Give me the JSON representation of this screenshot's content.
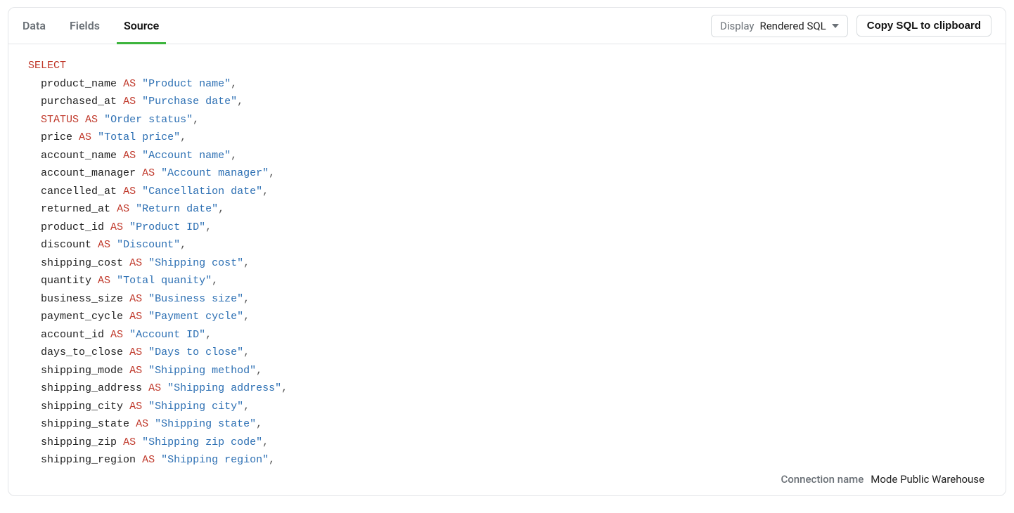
{
  "tabs": [
    {
      "label": "Data",
      "active": false
    },
    {
      "label": "Fields",
      "active": false
    },
    {
      "label": "Source",
      "active": true
    }
  ],
  "display_control": {
    "label": "Display",
    "value": "Rendered SQL"
  },
  "copy_button_label": "Copy SQL to clipboard",
  "sql": {
    "keyword_select": "SELECT",
    "keyword_as": "AS",
    "comma": ",",
    "indent": "  ",
    "columns": [
      {
        "col": "product_name",
        "alias": "\"Product name\""
      },
      {
        "col": "purchased_at",
        "alias": "\"Purchase date\""
      },
      {
        "col": "STATUS",
        "col_is_keyword": true,
        "alias": "\"Order status\""
      },
      {
        "col": "price",
        "alias": "\"Total price\""
      },
      {
        "col": "account_name",
        "alias": "\"Account name\""
      },
      {
        "col": "account_manager",
        "alias": "\"Account manager\""
      },
      {
        "col": "cancelled_at",
        "alias": "\"Cancellation date\""
      },
      {
        "col": "returned_at",
        "alias": "\"Return date\""
      },
      {
        "col": "product_id",
        "alias": "\"Product ID\""
      },
      {
        "col": "discount",
        "alias": "\"Discount\""
      },
      {
        "col": "shipping_cost",
        "alias": "\"Shipping cost\""
      },
      {
        "col": "quantity",
        "alias": "\"Total quanity\""
      },
      {
        "col": "business_size",
        "alias": "\"Business size\""
      },
      {
        "col": "payment_cycle",
        "alias": "\"Payment cycle\""
      },
      {
        "col": "account_id",
        "alias": "\"Account ID\""
      },
      {
        "col": "days_to_close",
        "alias": "\"Days to close\""
      },
      {
        "col": "shipping_mode",
        "alias": "\"Shipping method\""
      },
      {
        "col": "shipping_address",
        "alias": "\"Shipping address\""
      },
      {
        "col": "shipping_city",
        "alias": "\"Shipping city\""
      },
      {
        "col": "shipping_state",
        "alias": "\"Shipping state\""
      },
      {
        "col": "shipping_zip",
        "alias": "\"Shipping zip code\""
      },
      {
        "col": "shipping_region",
        "alias": "\"Shipping region\""
      }
    ]
  },
  "footer": {
    "label": "Connection name",
    "value": "Mode Public Warehouse"
  }
}
